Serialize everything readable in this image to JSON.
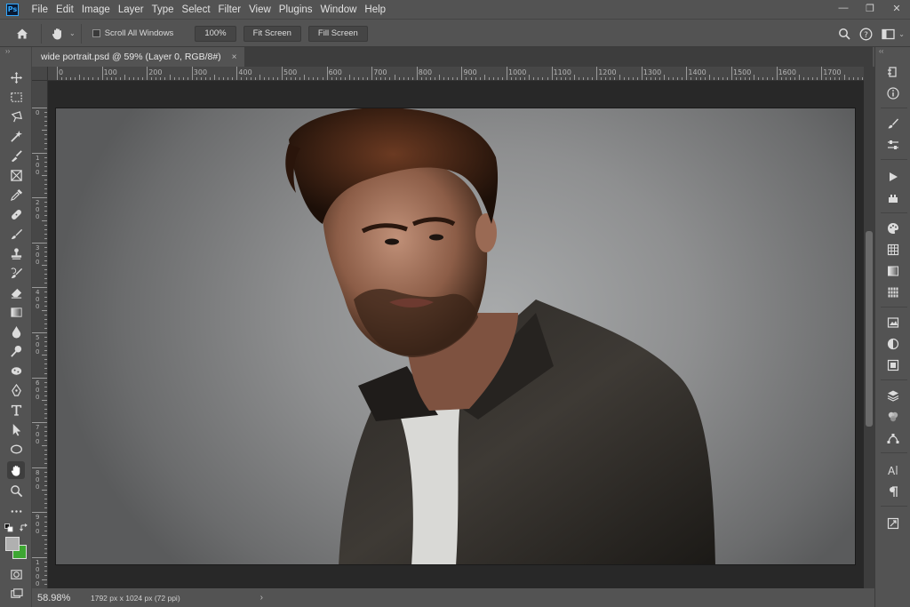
{
  "menubar": {
    "logo": "Ps",
    "items": [
      "File",
      "Edit",
      "Image",
      "Layer",
      "Type",
      "Select",
      "Filter",
      "View",
      "Plugins",
      "Window",
      "Help"
    ],
    "window_controls": [
      "—",
      "❐",
      "✕"
    ]
  },
  "options": {
    "scroll_all_windows": "Scroll All Windows",
    "zoom_100": "100%",
    "fit_screen": "Fit Screen",
    "fill_screen": "Fill Screen"
  },
  "tab": {
    "title": "wide portrait.psd @ 59% (Layer 0, RGB/8#)",
    "close": "×"
  },
  "ruler_top": [
    "0",
    "100",
    "200",
    "300",
    "400",
    "500",
    "600",
    "700",
    "800",
    "900",
    "1000",
    "1100",
    "1200",
    "1300",
    "1400",
    "1500",
    "1600",
    "1700"
  ],
  "ruler_left": [
    "0",
    "100",
    "200",
    "300",
    "400",
    "500",
    "600",
    "700",
    "800",
    "900",
    "1000"
  ],
  "status": {
    "zoom": "58.98%",
    "doc_info": "1792 px x 1024 px (72 ppi)",
    "arrow": "›"
  },
  "colors": {
    "foreground": "#b0b0b0",
    "background": "#3da632",
    "ui_bg": "#535353",
    "canvas_bg": "#282828"
  },
  "tools": [
    "move-tool-icon",
    "marquee-tool-icon",
    "lasso-tool-icon",
    "magic-wand-icon",
    "brush-select-icon",
    "frame-tool-icon",
    "eyedropper-icon",
    "healing-brush-icon",
    "brush-tool-icon",
    "clone-stamp-icon",
    "history-brush-icon",
    "eraser-icon",
    "gradient-tool-icon",
    "blur-tool-icon",
    "dodge-tool-icon",
    "sponge-tool-icon",
    "pen-tool-icon",
    "type-tool-icon",
    "path-select-icon",
    "ellipse-tool-icon",
    "hand-tool-icon",
    "zoom-tool-icon",
    "more-tools-icon"
  ],
  "right_panel": [
    "history-icon",
    "info-icon",
    "brushes-icon",
    "adjust-icon",
    "actions-icon",
    "tool-presets-icon",
    "color-icon",
    "swatches-icon",
    "gradients-icon",
    "patterns-icon",
    "libraries-icon",
    "adjustments-icon",
    "properties-icon",
    "layers-icon",
    "channels-icon",
    "paths-icon",
    "character-icon",
    "paragraph-icon",
    "glyphs-icon"
  ]
}
